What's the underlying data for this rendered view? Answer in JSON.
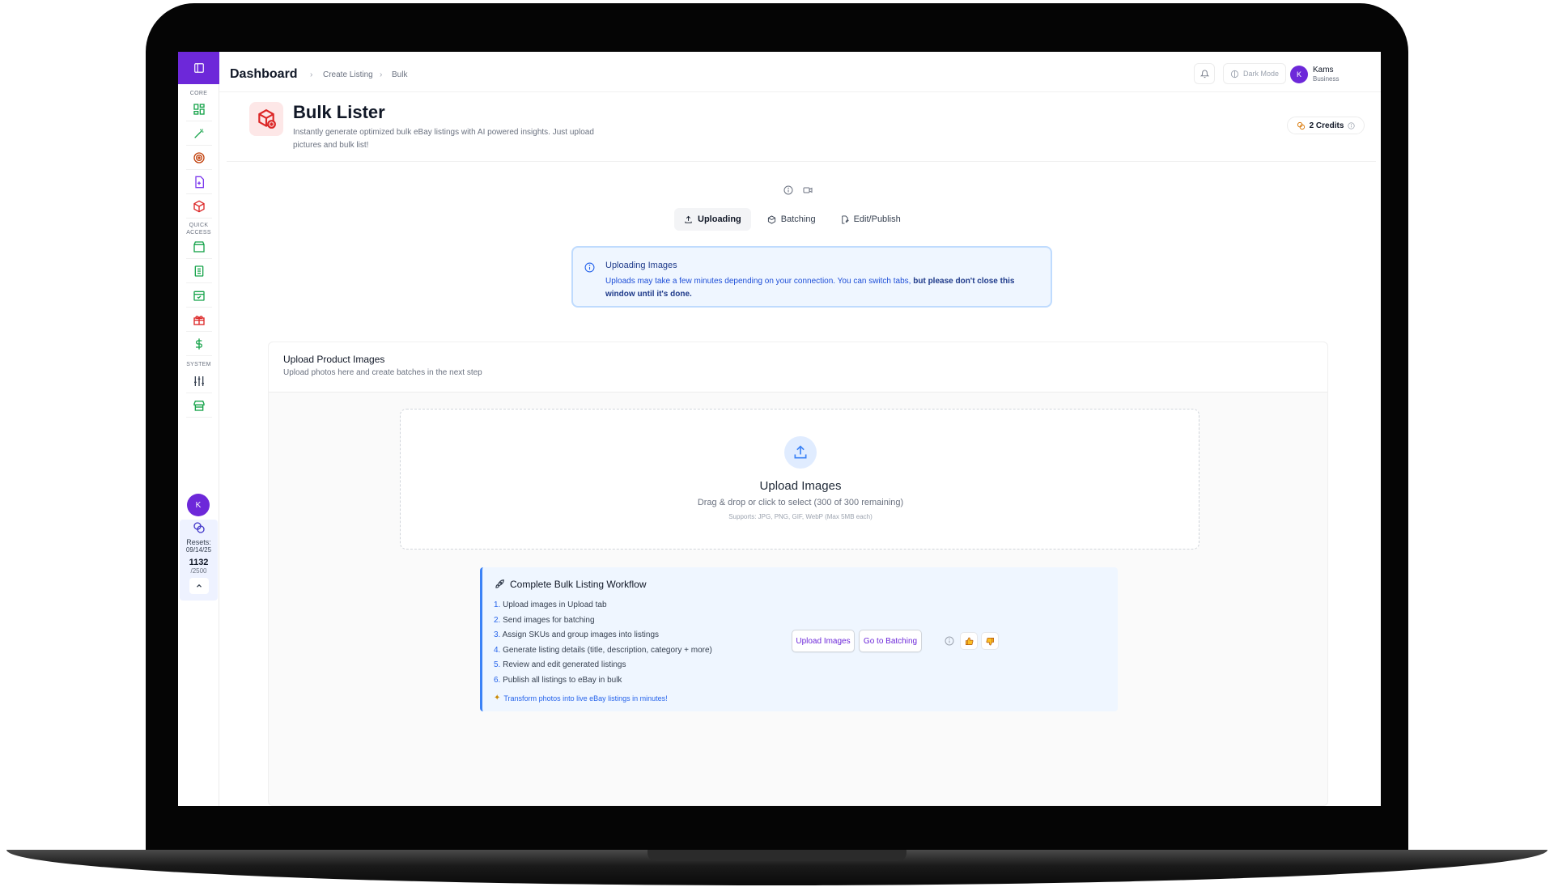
{
  "sidebar": {
    "sections": {
      "core": "CORE",
      "quick_access": "QUICK ACCESS",
      "system": "SYSTEM"
    },
    "core_icons": [
      "dashboard-icon",
      "magic-wand-icon",
      "target-icon",
      "file-plus-icon",
      "package-plus-icon"
    ],
    "quick_icons": [
      "store-icon",
      "notebook-icon",
      "calendar-check-icon",
      "gift-icon",
      "dollar-icon"
    ],
    "system_icons": [
      "sliders-icon",
      "store-front-icon"
    ],
    "avatar_initial": "K",
    "credits": {
      "resets_label": "Resets:",
      "resets_date": "09/14/25",
      "used": "1132",
      "total": "/2500"
    }
  },
  "topbar": {
    "breadcrumb": {
      "main": "Dashboard",
      "level1": "Create Listing",
      "level2": "Bulk"
    },
    "dark_mode_label": "Dark Mode",
    "user": {
      "initial": "K",
      "name": "Kams",
      "role": "Business"
    }
  },
  "header": {
    "title": "Bulk Lister",
    "description": "Instantly generate optimized bulk eBay listings with AI powered insights. Just upload pictures and bulk list!",
    "credits": "2 Credits"
  },
  "tabs": [
    {
      "label": "Uploading",
      "active": true
    },
    {
      "label": "Batching",
      "active": false
    },
    {
      "label": "Edit/Publish",
      "active": false
    }
  ],
  "info_banner": {
    "title": "Uploading Images",
    "text": "Uploads may take a few minutes depending on your connection. You can switch tabs,",
    "bold_text": "but please don't close this window until it's done."
  },
  "upload": {
    "title": "Upload Product Images",
    "subtitle": "Upload photos here and create batches in the next step",
    "dropzone_title": "Upload Images",
    "dropzone_sub": "Drag & drop or click to select (300 of 300 remaining)",
    "dropzone_support": "Supports: JPG, PNG, GIF, WebP (Max 5MB each)"
  },
  "workflow": {
    "title": "Complete Bulk Listing Workflow",
    "steps": [
      {
        "num": "1.",
        "text": "Upload images in Upload tab"
      },
      {
        "num": "2.",
        "text": "Send images for batching"
      },
      {
        "num": "3.",
        "text": "Assign SKUs and group images into listings"
      },
      {
        "num": "4.",
        "text": "Generate listing details (title, description, category + more)"
      },
      {
        "num": "5.",
        "text": "Review and edit generated listings"
      },
      {
        "num": "6.",
        "text": "Publish all listings to eBay in bulk"
      }
    ],
    "footer": "Transform photos into live eBay listings in minutes!",
    "upload_button": "Upload Images",
    "batching_button": "Go to Batching"
  },
  "colors": {
    "accent": "#6d28d9",
    "icon_green": "#16a34a",
    "icon_red": "#dc2626",
    "info_blue": "#2563eb"
  }
}
